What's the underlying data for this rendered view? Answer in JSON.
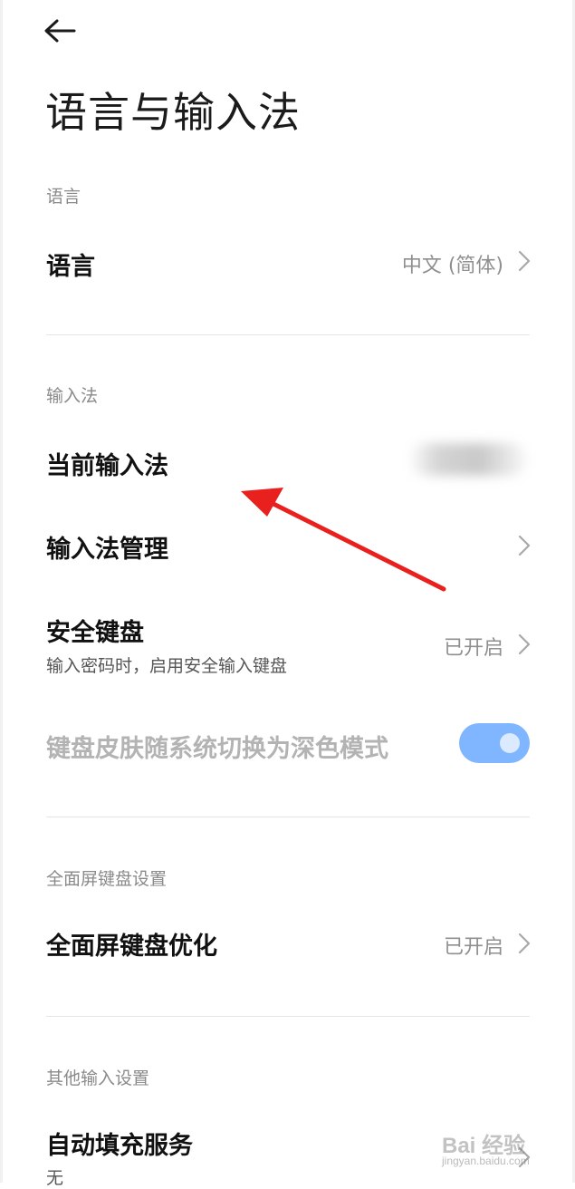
{
  "header": {
    "title": "语言与输入法"
  },
  "sections": {
    "language": {
      "header": "语言",
      "language_row": {
        "title": "语言",
        "value": "中文 (简体)"
      }
    },
    "input_method": {
      "header": "输入法",
      "current": {
        "title": "当前输入法"
      },
      "manage": {
        "title": "输入法管理"
      },
      "secure_keyboard": {
        "title": "安全键盘",
        "subtitle": "输入密码时，启用安全输入键盘",
        "value": "已开启"
      },
      "dark_skin": {
        "title": "键盘皮肤随系统切换为深色模式",
        "enabled": true
      }
    },
    "fullscreen": {
      "header": "全面屏键盘设置",
      "optimize": {
        "title": "全面屏键盘优化",
        "value": "已开启"
      }
    },
    "other": {
      "header": "其他输入设置",
      "autofill": {
        "title": "自动填充服务",
        "subtitle": "无"
      }
    }
  },
  "watermark": {
    "logo": "Bai 经验",
    "sub": "jingyan.baidu.com"
  },
  "colors": {
    "accent_toggle": "#7fb6ff",
    "annotation_arrow": "#e8211f",
    "secondary_text": "#8f8f8f"
  },
  "icons": {
    "back": "arrow-left-icon",
    "row_chevron": "chevron-right-icon",
    "annotation": "red-pointer-arrow"
  }
}
